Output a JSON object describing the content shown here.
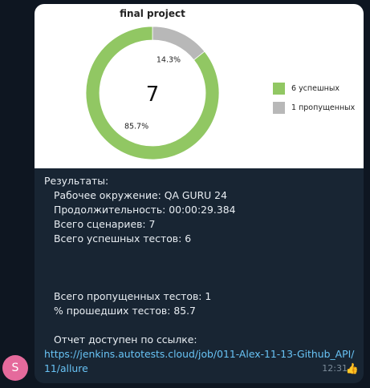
{
  "chart_data": {
    "type": "pie",
    "title": "final project",
    "center_label": "7",
    "categories": [
      "6 успешных",
      "1 пропущенных"
    ],
    "values": [
      6,
      1
    ],
    "labels": [
      "85.7%",
      "14.3%"
    ],
    "colors": [
      "#91c763",
      "#b8b8b8"
    ],
    "legend_position": "right"
  },
  "results": {
    "header": "Результаты:",
    "environment": "Рабочее окружение: QA GURU 24",
    "duration": "Продолжительность: 00:00:29.384",
    "total_scenarios": "Всего сценариев: 7",
    "total_passed": "Всего успешных тестов: 6",
    "total_skipped": "Всего пропущенных тестов: 1",
    "percent_passed": "% прошедших тестов: 85.7",
    "report_label": "Отчет доступен по ссылке:",
    "report_link": "https://jenkins.autotests.cloud/job/011-Alex-11-13-Github_API/11/allure"
  },
  "message": {
    "avatar_letter": "S",
    "time": "12:31",
    "reaction": "👍"
  }
}
